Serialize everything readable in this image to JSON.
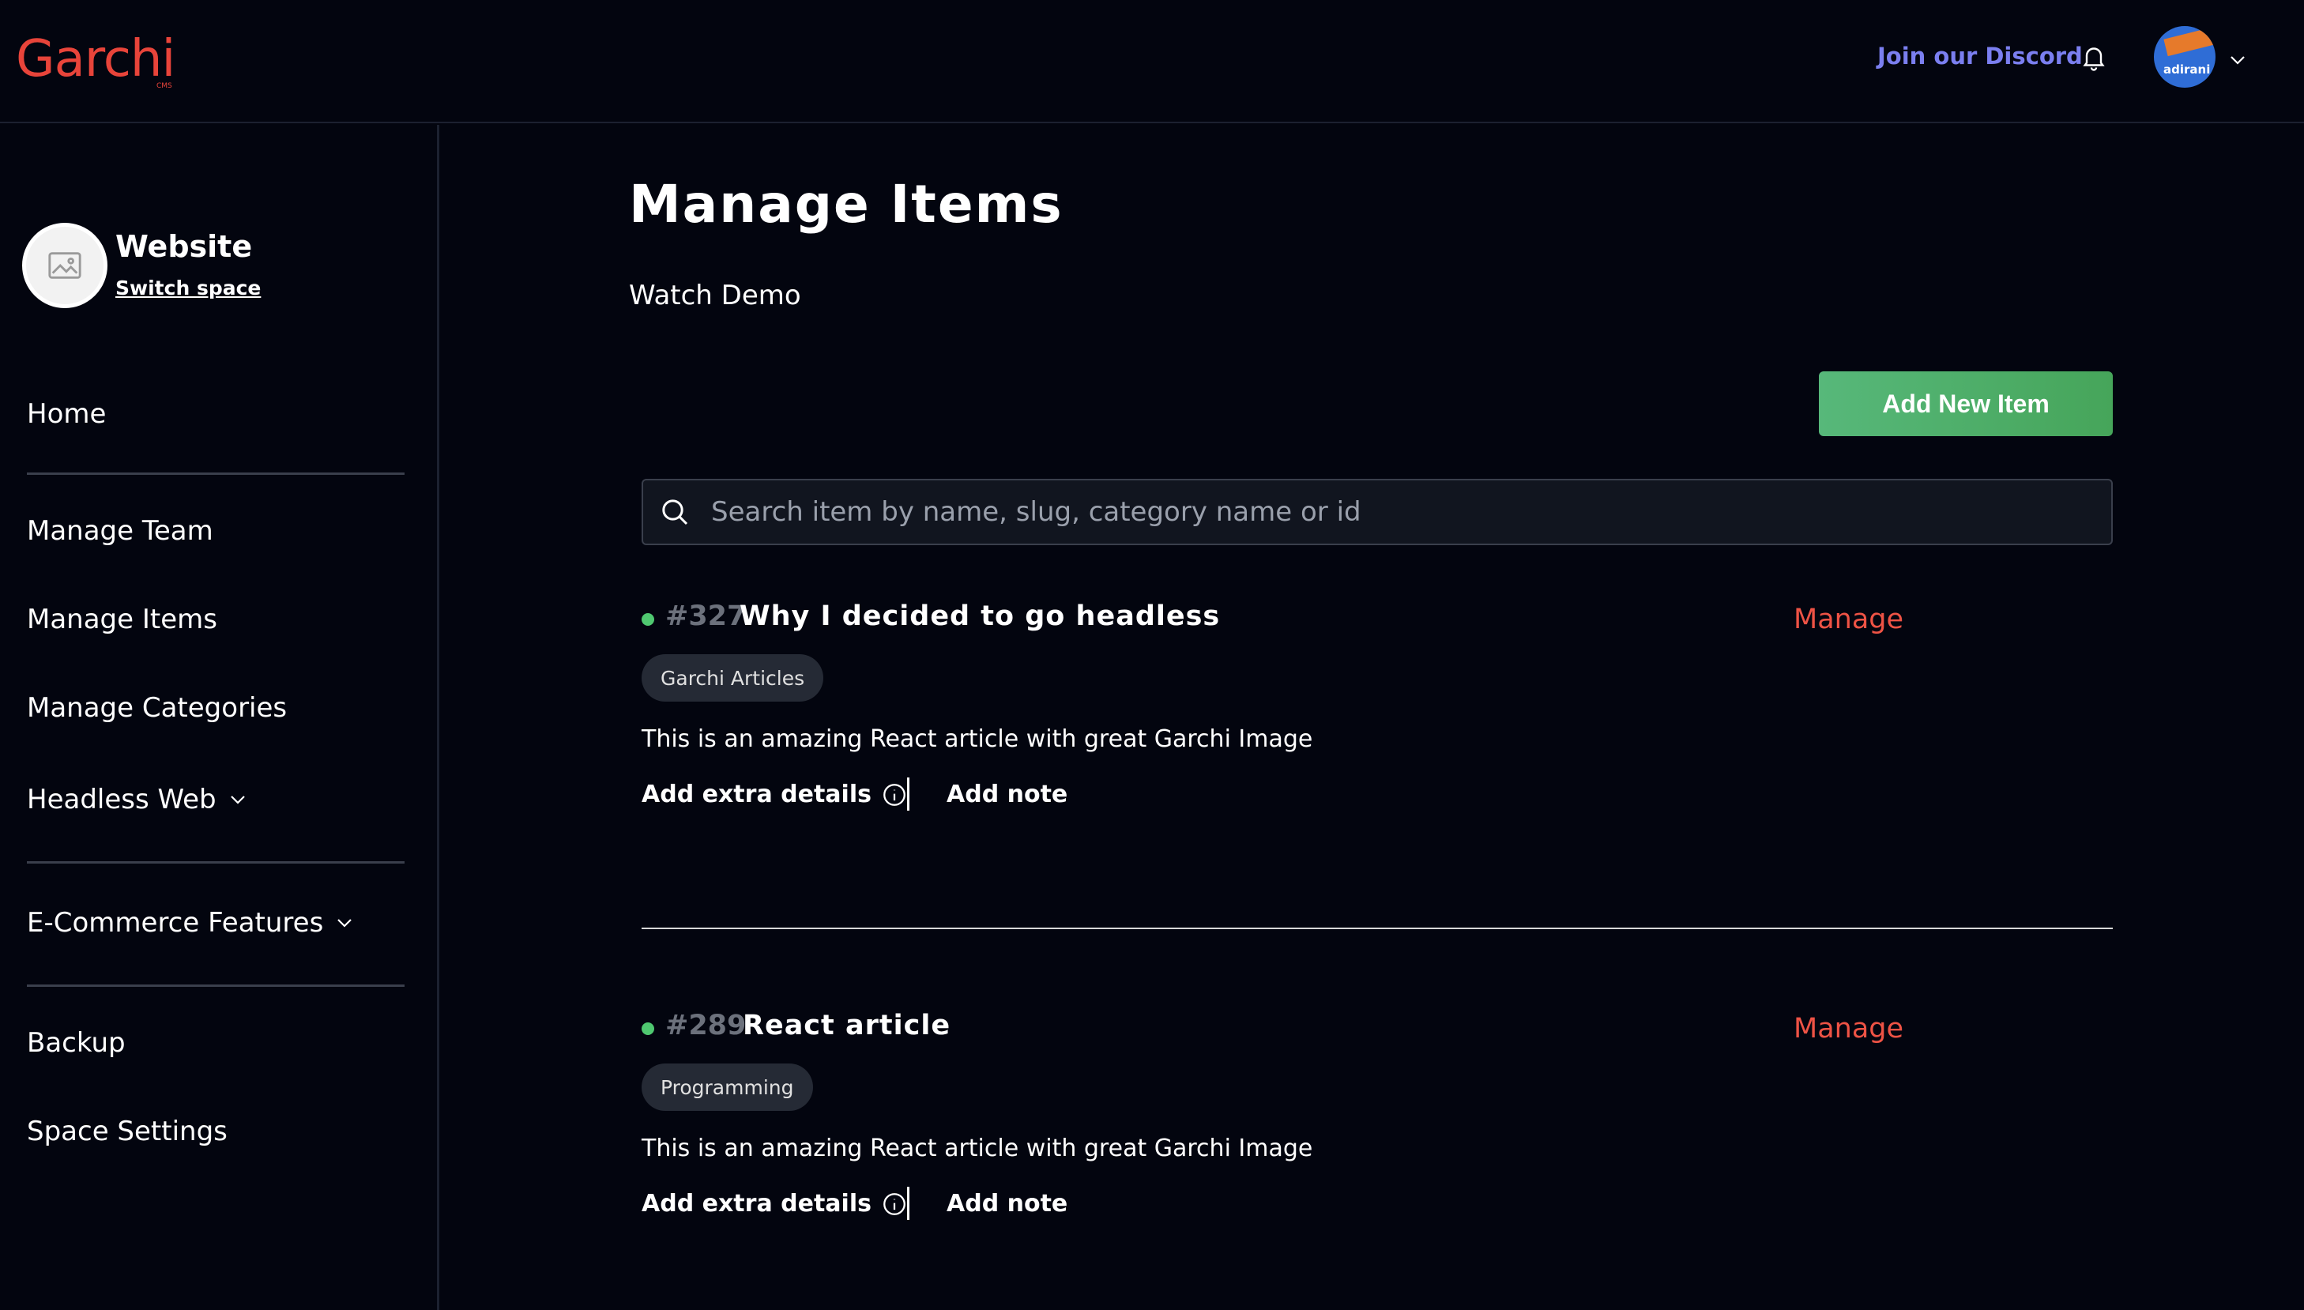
{
  "header": {
    "logo": "Garchi",
    "logo_sub": "CMS",
    "discord_link": "Join our Discord",
    "avatar_text": "adirani"
  },
  "sidebar": {
    "space_name": "Website",
    "switch_space": "Switch space",
    "items": [
      {
        "label": "Home"
      },
      {
        "label": "Manage Team"
      },
      {
        "label": "Manage Items"
      },
      {
        "label": "Manage Categories"
      },
      {
        "label": "Headless Web"
      },
      {
        "label": "E-Commerce Features"
      },
      {
        "label": "Backup"
      },
      {
        "label": "Space Settings"
      }
    ]
  },
  "main": {
    "title": "Manage Items",
    "watch_demo": "Watch Demo",
    "add_button": "Add New Item",
    "search_placeholder": "Search item by name, slug, category name or id",
    "items": [
      {
        "id": "#327",
        "title": "Why I decided to go headless",
        "manage": "Manage",
        "tag": "Garchi Articles",
        "description": "This is an amazing React article with great Garchi Image",
        "extra_details": "Add extra details",
        "add_note": "Add note",
        "status_color": "#4fc870"
      },
      {
        "id": "#289",
        "title": "React article",
        "manage": "Manage",
        "tag": "Programming",
        "description": "This is an amazing React article with great Garchi Image",
        "extra_details": "Add extra details",
        "add_note": "Add note",
        "status_color": "#4fc870"
      }
    ]
  },
  "colors": {
    "background": "#03050f",
    "accent_red": "#ee5345",
    "discord_blue": "#7b7ff0",
    "button_green": "#4caf63"
  }
}
